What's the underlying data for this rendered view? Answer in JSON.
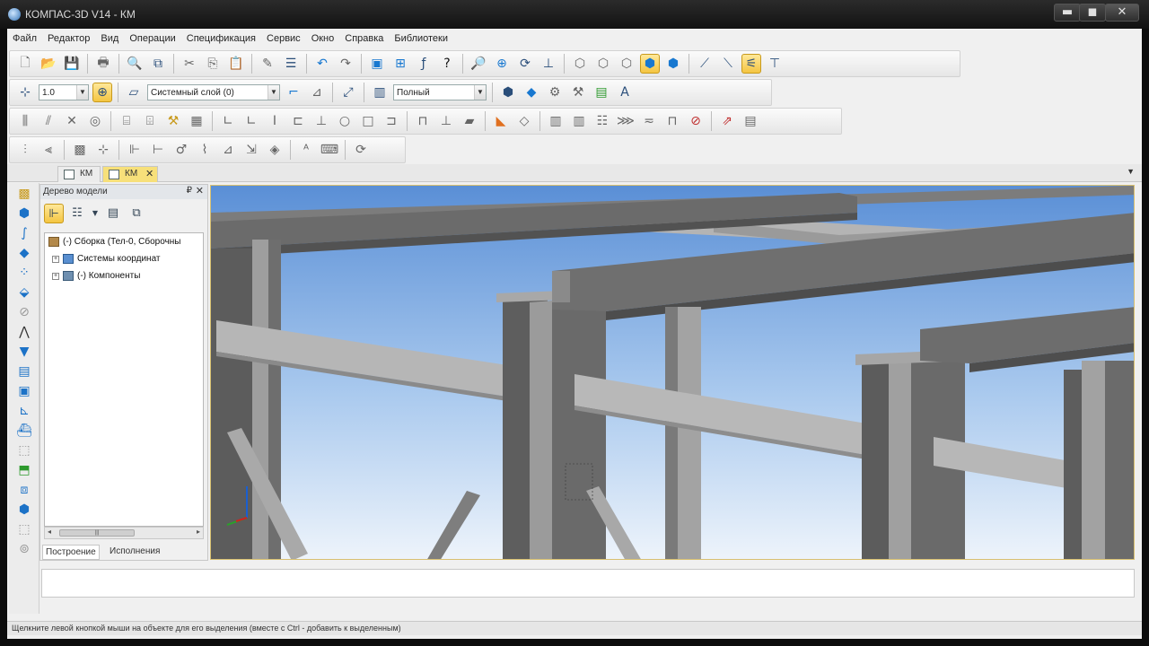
{
  "window": {
    "title": "КОМПАС-3D V14 - КМ",
    "minimize": "▬",
    "maximize": "◼",
    "close": "✕"
  },
  "menu": [
    "Файл",
    "Редактор",
    "Вид",
    "Операции",
    "Спецификация",
    "Сервис",
    "Окно",
    "Справка",
    "Библиотеки"
  ],
  "toolbar": {
    "scale_value": "1.0",
    "layer_value": "Системный слой (0)",
    "style_value": "Полный"
  },
  "doc_tabs": [
    {
      "label": "КМ",
      "active": false
    },
    {
      "label": "КМ",
      "active": true,
      "close": "✕"
    }
  ],
  "tree_panel": {
    "title": "Дерево модели",
    "pin": "₽",
    "close": "✕",
    "nodes": [
      {
        "label": "(-) Сборка (Тел-0, Сборочны",
        "expander": ""
      },
      {
        "label": "Системы координат",
        "expander": "+"
      },
      {
        "label": "(-) Компоненты",
        "expander": "+"
      }
    ],
    "scroll_left": "◂",
    "scroll_right": "▸",
    "scroll_thumb": "|||",
    "tabs": [
      "Построение",
      "Исполнения"
    ]
  },
  "status_bar": {
    "text": "Щелкните левой кнопкой мыши на объекте для его выделения (вместе с Ctrl - добавить к выделенным)"
  },
  "icons": {
    "row1": [
      "new-file-icon",
      "open-folder-icon",
      "save-icon",
      "print-icon",
      "preview-icon",
      "cut-icon",
      "copy-icon",
      "paste-icon",
      "properties-icon",
      "undo-icon",
      "redo-icon",
      "manager-icon",
      "variables-icon",
      "function-icon",
      "help-cursor-icon",
      "zoom-icon",
      "zoom-window-icon",
      "rotate-icon",
      "orient-icon",
      "wireframe-icon",
      "hidden-lines-icon",
      "thin-lines-icon",
      "shaded-icon",
      "shaded-edges-icon",
      "perspective-icon",
      "section-icon",
      "snap-icon",
      "measure-icon"
    ],
    "accent": "#f4c542"
  }
}
